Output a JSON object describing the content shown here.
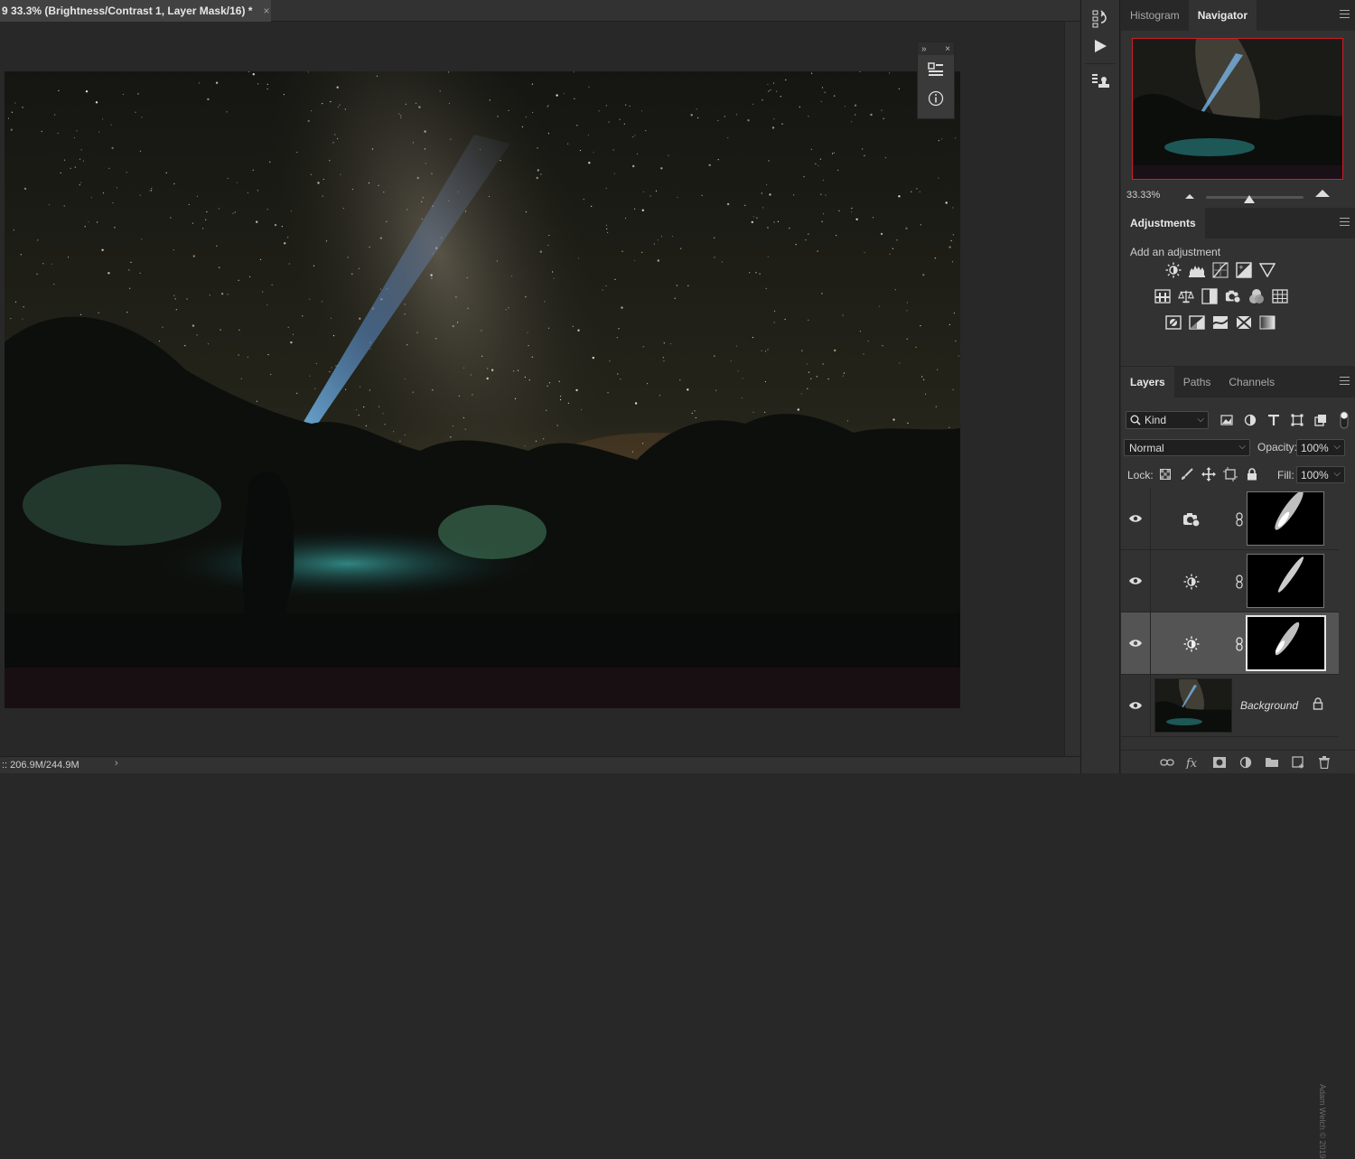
{
  "document": {
    "tab_title": "9 33.3% (Brightness/Contrast 1, Layer Mask/16) *",
    "tab_close": "×",
    "status_doc_size": ":: 206.9M/244.9M",
    "status_arrow": "›"
  },
  "float_panel": {
    "collapse": "»",
    "close": "×",
    "icons": [
      "properties-icon",
      "info-icon"
    ]
  },
  "toolstrip": {
    "icons": [
      "history-icon",
      "actions-play-icon",
      "clone-source-icon"
    ]
  },
  "navigator_panel": {
    "tabs": [
      "Histogram",
      "Navigator"
    ],
    "active_tab": "Navigator",
    "zoom": "33.33%",
    "zoom_slider_percent": 44
  },
  "adjustments_panel": {
    "tab": "Adjustments",
    "hint": "Add an adjustment",
    "rows": [
      [
        "brightness-contrast-icon",
        "levels-icon",
        "curves-icon",
        "exposure-icon",
        "vibrance-icon"
      ],
      [
        "hue-saturation-icon",
        "color-balance-icon",
        "black-white-icon",
        "photo-filter-icon",
        "channel-mixer-icon",
        "color-lookup-icon"
      ],
      [
        "invert-icon",
        "posterize-icon",
        "threshold-icon",
        "selective-color-icon",
        "gradient-map-icon"
      ]
    ]
  },
  "layers_panel": {
    "tabs": [
      "Layers",
      "Paths",
      "Channels"
    ],
    "active_tab": "Layers",
    "filter_kind": "Kind",
    "blend_mode": "Normal",
    "opacity_label": "Opacity:",
    "opacity_value": "100%",
    "lock_label": "Lock:",
    "fill_label": "Fill:",
    "fill_value": "100%",
    "layers": [
      {
        "type": "photo-filter",
        "visible": true,
        "selected": false
      },
      {
        "type": "brightness-contrast",
        "visible": true,
        "selected": false
      },
      {
        "type": "brightness-contrast",
        "visible": true,
        "selected": true
      },
      {
        "type": "background",
        "name": "Background",
        "visible": true,
        "locked": true
      }
    ],
    "watermark": "Adam Welch © 2019"
  }
}
